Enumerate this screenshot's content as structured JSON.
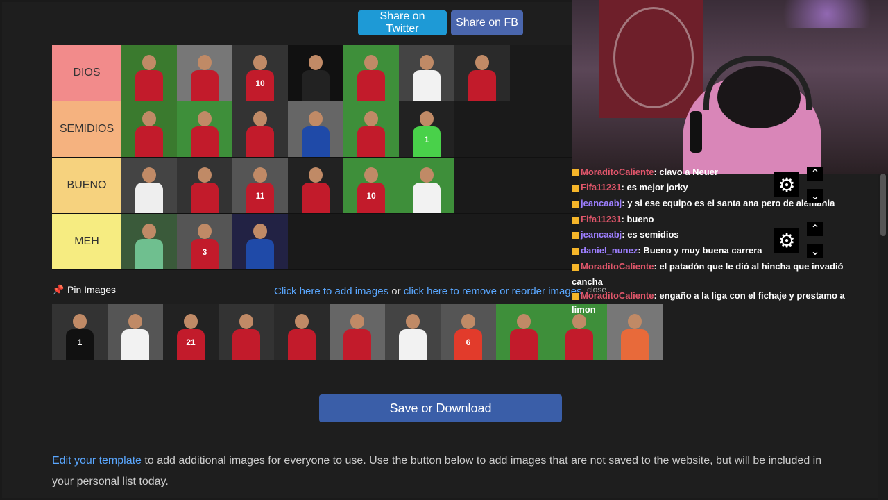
{
  "share": {
    "twitter": "Share on Twitter",
    "fb": "Share on FB"
  },
  "tiers": [
    {
      "label": "DIOS",
      "color": "#f28b8b",
      "players": [
        {
          "num": "",
          "shirt": "#c21b2b",
          "bg": "#3a7a2e"
        },
        {
          "num": "",
          "shirt": "#c21b2b",
          "bg": "#777"
        },
        {
          "num": "10",
          "shirt": "#c21b2b",
          "bg": "#333"
        },
        {
          "num": "",
          "shirt": "#222",
          "bg": "#111"
        },
        {
          "num": "",
          "shirt": "#c21b2b",
          "bg": "#3e8f3a"
        },
        {
          "num": "",
          "shirt": "#f2f2f2",
          "bg": "#444"
        },
        {
          "num": "",
          "shirt": "#c21b2b",
          "bg": "#2a2a2a"
        }
      ]
    },
    {
      "label": "SEMIDIOS",
      "color": "#f5b27f",
      "players": [
        {
          "num": "",
          "shirt": "#c21b2b",
          "bg": "#3a7a2e"
        },
        {
          "num": "",
          "shirt": "#c21b2b",
          "bg": "#3e8f3a"
        },
        {
          "num": "",
          "shirt": "#c21b2b",
          "bg": "#333"
        },
        {
          "num": "",
          "shirt": "#1f4aa8",
          "bg": "#666"
        },
        {
          "num": "",
          "shirt": "#c21b2b",
          "bg": "#3e8f3a"
        },
        {
          "num": "1",
          "shirt": "#49d14a",
          "bg": "#222"
        }
      ]
    },
    {
      "label": "BUENO",
      "color": "#f6d27e",
      "players": [
        {
          "num": "",
          "shirt": "#eee",
          "bg": "#444"
        },
        {
          "num": "",
          "shirt": "#c21b2b",
          "bg": "#333"
        },
        {
          "num": "11",
          "shirt": "#c21b2b",
          "bg": "#555"
        },
        {
          "num": "",
          "shirt": "#c21b2b",
          "bg": "#222"
        },
        {
          "num": "10",
          "shirt": "#c21b2b",
          "bg": "#3e8f3a"
        },
        {
          "num": "",
          "shirt": "#f2f2f2",
          "bg": "#3e8f3a"
        }
      ]
    },
    {
      "label": "MEH",
      "color": "#f6ec81",
      "players": [
        {
          "num": "",
          "shirt": "#6fbf8f",
          "bg": "#3a5a3a"
        },
        {
          "num": "3",
          "shirt": "#c21b2b",
          "bg": "#555"
        },
        {
          "num": "",
          "shirt": "#1f4aa8",
          "bg": "#224"
        }
      ]
    }
  ],
  "pin_label": "Pin Images",
  "links": {
    "add": "Click here to add images",
    "or": "or",
    "remove": "click here to remove or reorder images"
  },
  "pool": [
    {
      "num": "1",
      "shirt": "#111",
      "bg": "#333"
    },
    {
      "num": "",
      "shirt": "#f2f2f2",
      "bg": "#555"
    },
    {
      "num": "21",
      "shirt": "#c21b2b",
      "bg": "#222"
    },
    {
      "num": "",
      "shirt": "#c21b2b",
      "bg": "#333"
    },
    {
      "num": "",
      "shirt": "#c21b2b",
      "bg": "#2a2a2a"
    },
    {
      "num": "",
      "shirt": "#c21b2b",
      "bg": "#666"
    },
    {
      "num": "",
      "shirt": "#f2f2f2",
      "bg": "#444"
    },
    {
      "num": "6",
      "shirt": "#e23b2b",
      "bg": "#555"
    },
    {
      "num": "",
      "shirt": "#c21b2b",
      "bg": "#3e8f3a"
    },
    {
      "num": "",
      "shirt": "#c21b2b",
      "bg": "#3e8f3a"
    },
    {
      "num": "",
      "shirt": "#e86a3a",
      "bg": "#777"
    }
  ],
  "save_label": "Save or Download",
  "bottom": {
    "link": "Edit your template",
    "text": " to add additional images for everyone to use. Use the button below to add images that are not saved to the website, but will be included in your personal list today."
  },
  "chat": [
    {
      "user": "MoraditoCaliente",
      "user_color": "#e0566a",
      "text": ": clavo a Neuer"
    },
    {
      "user": "Fifa11231",
      "user_color": "#e0566a",
      "text": ": es mejor jorky"
    },
    {
      "user": "jeancaabj",
      "user_color": "#9d7fff",
      "text": ": y si ese equipo es el santa ana pero de alemania"
    },
    {
      "user": "Fifa11231",
      "user_color": "#e0566a",
      "text": ": bueno"
    },
    {
      "user": "jeancaabj",
      "user_color": "#9d7fff",
      "text": ": es semidios"
    },
    {
      "user": "daniel_nunez",
      "user_color": "#9d7fff",
      "text": ": Bueno y muy buena carrera"
    },
    {
      "user": "MoraditoCaliente",
      "user_color": "#e0566a",
      "text": ": el patadón que le dió al hincha que invadió"
    },
    {
      "user": "",
      "user_color": "#fff",
      "text": "cancha"
    },
    {
      "user": "MoraditoCaliente",
      "user_color": "#e0566a",
      "text": ": engaño a la liga con el fichaje y prestamo a"
    },
    {
      "user": "",
      "user_color": "#fff",
      "text": "limon"
    }
  ],
  "close_label": "close"
}
